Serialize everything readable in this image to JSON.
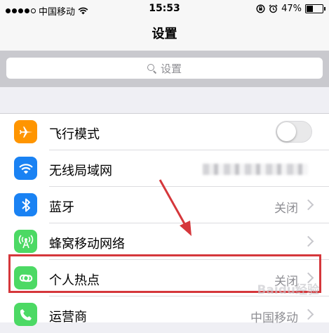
{
  "status_bar": {
    "carrier": "中国移动",
    "time": "15:53",
    "battery": "47%",
    "battery_level": 0.47,
    "signal_bars": 4
  },
  "nav": {
    "title": "设置"
  },
  "search": {
    "placeholder": "设置",
    "icon": "search-icon"
  },
  "settings": {
    "airplane": {
      "label": "飞行模式",
      "toggle_on": false,
      "icon": "airplane-icon",
      "color": "#ff9500"
    },
    "wifi": {
      "label": "无线局域网",
      "icon": "wifi-icon",
      "color": "#1a82f3"
    },
    "bluetooth": {
      "label": "蓝牙",
      "value": "关闭",
      "icon": "bluetooth-icon",
      "color": "#1a82f3"
    },
    "cellular": {
      "label": "蜂窝移动网络",
      "icon": "cellular-antenna-icon",
      "color": "#4cd964"
    },
    "hotspot": {
      "label": "个人热点",
      "value": "关闭",
      "icon": "hotspot-link-icon",
      "color": "#4cd964"
    },
    "carrier": {
      "label": "运营商",
      "value": "中国移动",
      "icon": "phone-icon",
      "color": "#4cd964"
    }
  },
  "annotation": {
    "highlight_color": "#d5373b"
  },
  "watermark": {
    "text": "Baidu经验"
  }
}
